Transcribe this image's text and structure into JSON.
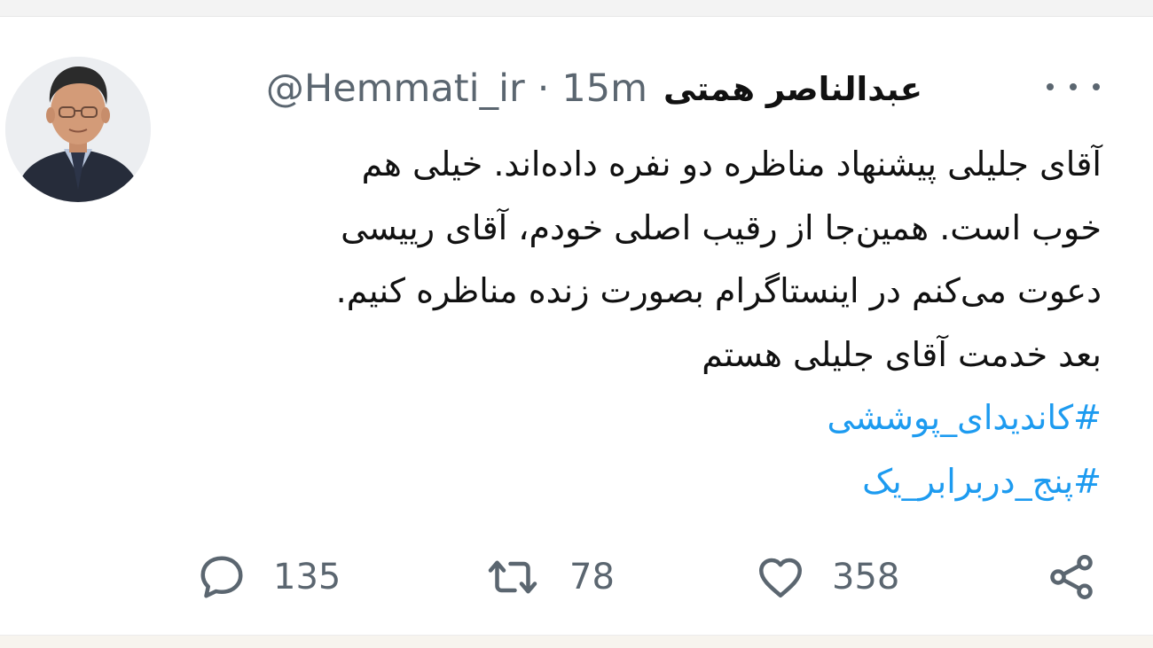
{
  "tweet": {
    "author": {
      "display_name": "عبدالناصر همتی",
      "handle": "@Hemmati_ir"
    },
    "separator": "·",
    "time": "15m",
    "text_lines": [
      "آقای جلیلی پیشنهاد مناظره دو نفره داده‌اند. خیلی هم",
      "خوب است. همین‌جا از رقیب اصلی خودم، آقای رییسی",
      "دعوت می‌کنم در اینستاگرام بصورت زنده مناظره کنیم.",
      "بعد خدمت آقای جلیلی هستم"
    ],
    "hashtags": [
      "#کاندیدای_پوششی",
      "#پنج_دربرابر_یک"
    ],
    "stats": {
      "replies": "135",
      "retweets": "78",
      "likes": "358"
    },
    "icons": {
      "more": "more-horizontal-icon",
      "reply": "comment-bubble-icon",
      "retweet": "retweet-icon",
      "like": "heart-icon",
      "share": "share-icon"
    },
    "colors": {
      "text": "#111111",
      "secondary": "#5b6670",
      "link": "#1d9bf0"
    }
  }
}
